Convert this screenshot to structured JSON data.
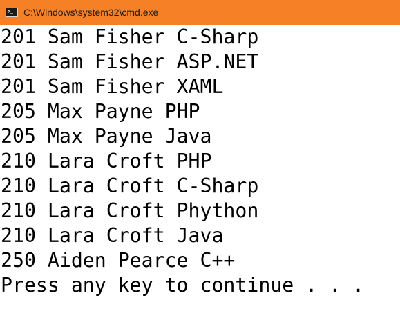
{
  "window": {
    "title": "C:\\Windows\\system32\\cmd.exe",
    "titlebar_color": "#f58025",
    "icon": "console-icon"
  },
  "console": {
    "lines": [
      "201 Sam Fisher C-Sharp",
      "201 Sam Fisher ASP.NET",
      "201 Sam Fisher XAML",
      "205 Max Payne PHP",
      "205 Max Payne Java",
      "210 Lara Croft PHP",
      "210 Lara Croft C-Sharp",
      "210 Lara Croft Phython",
      "210 Lara Croft Java",
      "250 Aiden Pearce C++",
      "Press any key to continue . . ."
    ],
    "background": "#ffffff",
    "foreground": "#000000"
  }
}
